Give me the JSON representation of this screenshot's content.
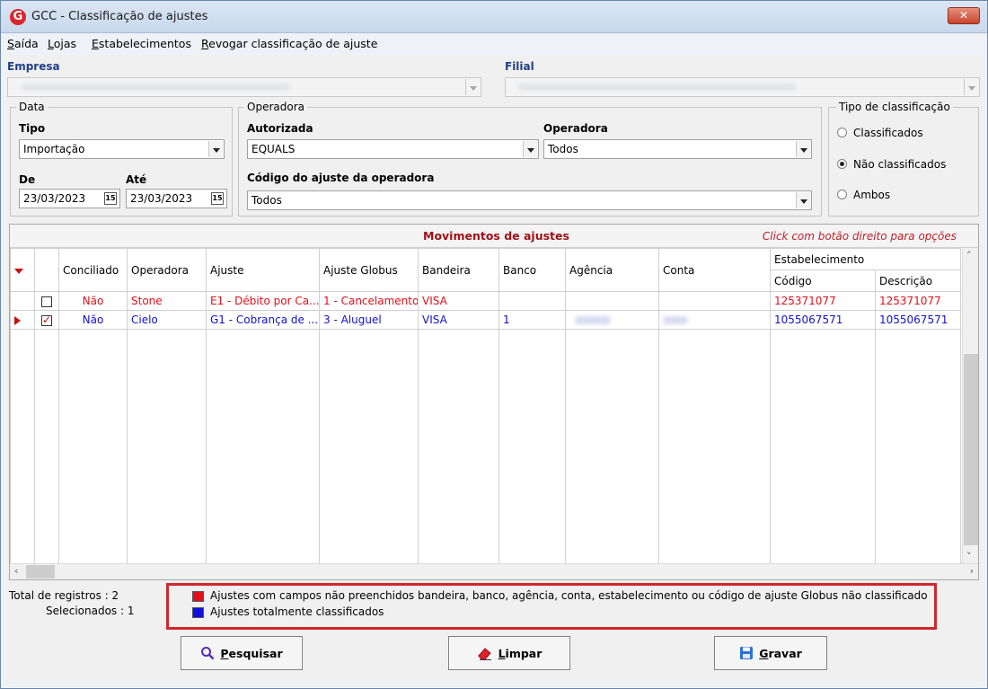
{
  "window": {
    "title": "GCC - Classificação de ajustes"
  },
  "menu": [
    "Saída",
    "Lojas",
    "Estabelecimentos",
    "Revogar classificação de ajuste"
  ],
  "empresa": {
    "label": "Empresa"
  },
  "filial": {
    "label": "Filial"
  },
  "data_group": {
    "title": "Data",
    "tipo_label": "Tipo",
    "tipo_value": "Importação",
    "de_label": "De",
    "de_value": "23/03/2023",
    "ate_label": "Até",
    "ate_value": "23/03/2023",
    "calendar_icon": "15"
  },
  "operadora_group": {
    "title": "Operadora",
    "autorizada_label": "Autorizada",
    "autorizada_value": "EQUALS",
    "operadora_label": "Operadora",
    "operadora_value": "Todos",
    "codigo_label": "Código do ajuste da operadora",
    "codigo_value": "Todos"
  },
  "tipo_classificacao": {
    "title": "Tipo de classificação",
    "options": [
      "Classificados",
      "Não classificados",
      "Ambos"
    ],
    "selected": "Não classificados"
  },
  "grid": {
    "title": "Movimentos de ajustes",
    "hint": "Click com botão direito para opções",
    "columns": [
      "Conciliado",
      "Operadora",
      "Ajuste",
      "Ajuste Globus",
      "Bandeira",
      "Banco",
      "Agência",
      "Conta",
      "Estabelecimento"
    ],
    "sub_columns": [
      "Código",
      "Descrição"
    ],
    "rows": [
      {
        "checked": false,
        "current": false,
        "color": "#e0101a",
        "conciliado": "Não",
        "operadora": "Stone",
        "ajuste": "E1 - Débito por Ca...",
        "ajuste_globus": "1 - Cancelamento",
        "bandeira": "VISA",
        "banco": "",
        "codigo": "125371077",
        "descricao": "125371077"
      },
      {
        "checked": true,
        "current": true,
        "color": "#1010d0",
        "conciliado": "Não",
        "operadora": "Cielo",
        "ajuste": "G1 - Cobrança de ...",
        "ajuste_globus": "3 - Aluguel",
        "bandeira": "VISA",
        "banco": "1",
        "codigo": "1055067571",
        "descricao": "1055067571"
      }
    ]
  },
  "stats": {
    "total_label": "Total de registros : 2",
    "selecionados_label": "Selecionados : 1"
  },
  "legend": {
    "items": [
      {
        "color": "#e0101a",
        "text": "Ajustes com campos não preenchidos bandeira, banco, agência, conta, estabelecimento ou código de ajuste Globus não classificado"
      },
      {
        "color": "#1010e0",
        "text": "Ajustes totalmente classificados"
      }
    ]
  },
  "buttons": {
    "pesquisar": "Pesquisar",
    "limpar": "Limpar",
    "gravar": "Gravar"
  },
  "colors": {
    "accent_red": "#d0262c",
    "label_blue": "#1f3f88"
  }
}
